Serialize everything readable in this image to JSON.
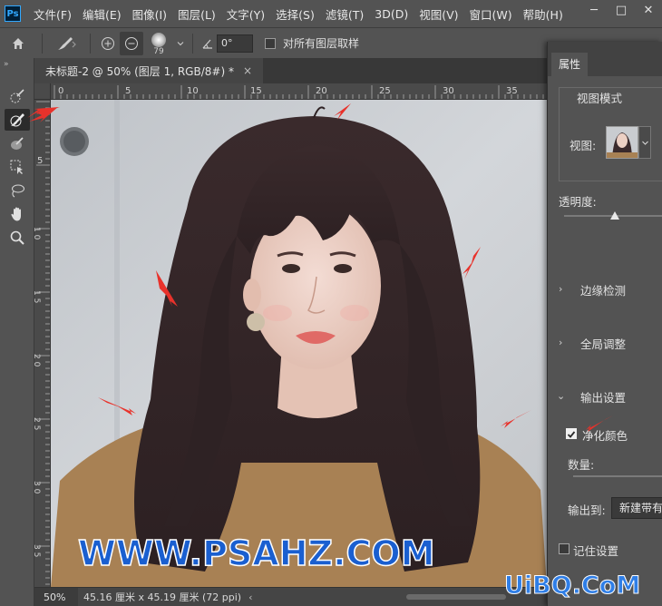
{
  "app": {
    "logo": "Ps",
    "menu": [
      "文件(F)",
      "编辑(E)",
      "图像(I)",
      "图层(L)",
      "文字(Y)",
      "选择(S)",
      "滤镜(T)",
      "3D(D)",
      "视图(V)",
      "窗口(W)",
      "帮助(H)"
    ],
    "window_controls": {
      "minimize": "─",
      "maximize": "□",
      "close": "✕"
    }
  },
  "options_bar": {
    "brush_size": "79",
    "angle_value": "0°",
    "sample_all_layers_label": "对所有图层取样"
  },
  "toolbar": {
    "collapse": "»",
    "tools": [
      "refine-edge-brush",
      "brush",
      "object-selection",
      "quick-selection",
      "lasso",
      "hand",
      "zoom"
    ],
    "active_tool": "brush"
  },
  "document": {
    "tab_title": "未标题-2 @ 50% (图层 1, RGB/8#) *",
    "tab_close": "×",
    "ruler_top_labels": [
      "0",
      "5",
      "10",
      "15",
      "20",
      "25",
      "30",
      "35"
    ],
    "ruler_left_labels": [
      "5",
      "1 0",
      "1 5",
      "2 0",
      "2 5",
      "3 0",
      "3 5"
    ]
  },
  "status": {
    "zoom": "50%",
    "doc_size": "45.16 厘米 x 45.19 厘米 (72 ppi)",
    "arrow": "‹"
  },
  "properties": {
    "tab": "属性",
    "view_mode_title": "视图模式",
    "view_label": "视图:",
    "transparency_label": "透明度:",
    "transparency_value": 0.5,
    "sections": {
      "edge_detection": "边缘检测",
      "global_refine": "全局调整",
      "output_settings": "输出设置"
    },
    "decontaminate_label": "净化颜色",
    "decontaminate_checked": true,
    "amount_label": "数量:",
    "output_to_label": "输出到:",
    "output_to_value": "新建带有图层蒙版的图层",
    "remember_label": "记住设置",
    "remember_checked": false
  },
  "overlays": {
    "watermark": "WWW.PSAHZ.COM",
    "brand": "UiBQ.CoM"
  },
  "colors": {
    "menu_bg": "#535353",
    "panel_bg": "#535353",
    "canvas_wall": "#c9ccd0",
    "arrow_red": "#e8322b",
    "ps_blue": "#31a8ff",
    "watermark_blue": "#1a5fd0"
  }
}
